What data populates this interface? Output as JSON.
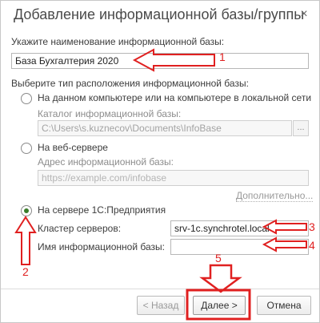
{
  "window": {
    "title": "Добавление информационной базы/группы",
    "close_glyph": "×"
  },
  "name_section": {
    "label": "Укажите наименование информационной базы:",
    "value": "База Бухгалтерия 2020"
  },
  "location": {
    "label": "Выберите тип расположения информационной базы:",
    "options": [
      {
        "label": "На данном компьютере или на компьютере в локальной сети",
        "selected": false,
        "sub_label": "Каталог информационной базы:",
        "sub_value": "C:\\Users\\s.kuznecov\\Documents\\InfoBase",
        "browse": "..."
      },
      {
        "label": "На веб-сервере",
        "selected": false,
        "sub_label": "Адрес информационной базы:",
        "sub_placeholder": "https://example.com/infobase",
        "more_link": "Дополнительно..."
      },
      {
        "label": "На сервере 1С:Предприятия",
        "selected": true,
        "cluster_label": "Кластер серверов:",
        "cluster_value": "srv-1c.synchrotel.local",
        "db_label": "Имя информационной базы:",
        "db_value": ""
      }
    ]
  },
  "buttons": {
    "back": "< Назад",
    "next": "Далее >",
    "cancel": "Отмена"
  },
  "annotations": {
    "color": "#e02020",
    "markers": [
      "1",
      "2",
      "3",
      "4",
      "5"
    ]
  }
}
